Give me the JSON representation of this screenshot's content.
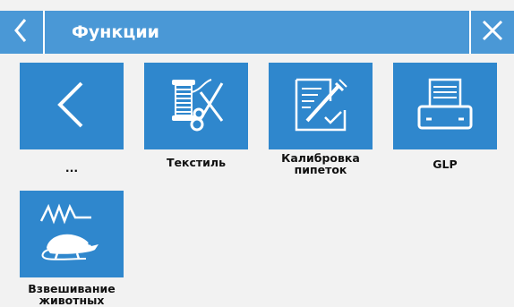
{
  "header": {
    "title": "Функции",
    "back_icon": "chevron-left-icon",
    "close_icon": "close-icon"
  },
  "tiles": [
    {
      "label": "...",
      "icon": "chevron-left-icon"
    },
    {
      "label": "Текстиль",
      "icon": "thread-scissors-icon"
    },
    {
      "label": "Калибровка\nпипеток",
      "icon": "pipette-document-icon"
    },
    {
      "label": "GLP",
      "icon": "printer-icon"
    },
    {
      "label": "Взвешивание\nживотных",
      "icon": "animal-weighing-icon"
    }
  ],
  "colors": {
    "header_bg": "#4a98d6",
    "tile_bg": "#2f87cd",
    "page_bg": "#f2f2f2"
  }
}
